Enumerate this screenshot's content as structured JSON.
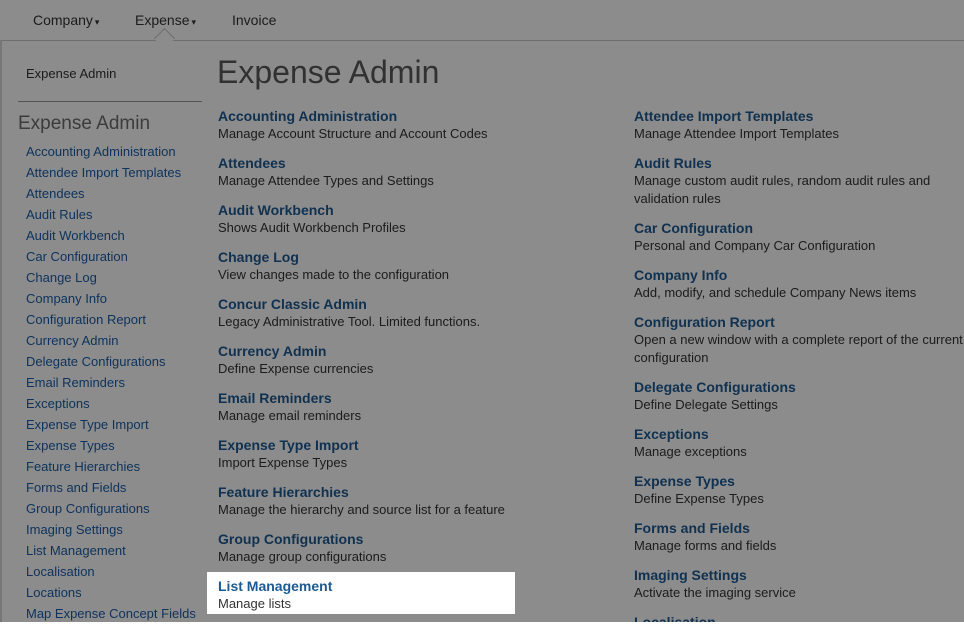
{
  "topnav": {
    "items": [
      {
        "label": "Company",
        "caret": "▾"
      },
      {
        "label": "Expense",
        "caret": "▾"
      },
      {
        "label": "Invoice"
      }
    ]
  },
  "sidebar": {
    "top_link": "Expense Admin",
    "heading": "Expense Admin",
    "items": [
      "Accounting Administration",
      "Attendee Import Templates",
      "Attendees",
      "Audit Rules",
      "Audit Workbench",
      "Car Configuration",
      "Change Log",
      "Company Info",
      "Configuration Report",
      "Currency Admin",
      "Delegate Configurations",
      "Email Reminders",
      "Exceptions",
      "Expense Type Import",
      "Expense Types",
      "Feature Hierarchies",
      "Forms and Fields",
      "Group Configurations",
      "Imaging Settings",
      "List Management",
      "Localisation",
      "Locations",
      "Map Expense Concept Fields"
    ]
  },
  "main": {
    "title": "Expense Admin",
    "col1": [
      {
        "title": "Accounting Administration",
        "desc": "Manage Account Structure and Account Codes"
      },
      {
        "title": "Attendees",
        "desc": "Manage Attendee Types and Settings"
      },
      {
        "title": "Audit Workbench",
        "desc": "Shows Audit Workbench Profiles"
      },
      {
        "title": "Change Log",
        "desc": "View changes made to the configuration"
      },
      {
        "title": "Concur Classic Admin",
        "desc": "Legacy Administrative Tool. Limited functions."
      },
      {
        "title": "Currency Admin",
        "desc": "Define Expense currencies"
      },
      {
        "title": "Email Reminders",
        "desc": "Manage email reminders"
      },
      {
        "title": "Expense Type Import",
        "desc": "Import Expense Types"
      },
      {
        "title": "Feature Hierarchies",
        "desc": "Manage the hierarchy and source list for a feature"
      },
      {
        "title": "Group Configurations",
        "desc": "Manage group configurations"
      }
    ],
    "col2": [
      {
        "title": "Attendee Import Templates",
        "desc": "Manage Attendee Import Templates"
      },
      {
        "title": "Audit Rules",
        "desc": "Manage custom audit rules, random audit rules and validation rules"
      },
      {
        "title": "Car Configuration",
        "desc": "Personal and Company Car Configuration"
      },
      {
        "title": "Company Info",
        "desc": "Add, modify, and schedule Company News items"
      },
      {
        "title": "Configuration Report",
        "desc": "Open a new window with a complete report of the current configuration"
      },
      {
        "title": "Delegate Configurations",
        "desc": "Define Delegate Settings"
      },
      {
        "title": "Exceptions",
        "desc": "Manage exceptions"
      },
      {
        "title": "Expense Types",
        "desc": "Define Expense Types"
      },
      {
        "title": "Forms and Fields",
        "desc": "Manage forms and fields"
      },
      {
        "title": "Imaging Settings",
        "desc": "Activate the imaging service"
      },
      {
        "title": "Localisation",
        "desc": ""
      }
    ],
    "highlighted": {
      "title": "List Management",
      "desc": "Manage lists"
    }
  }
}
